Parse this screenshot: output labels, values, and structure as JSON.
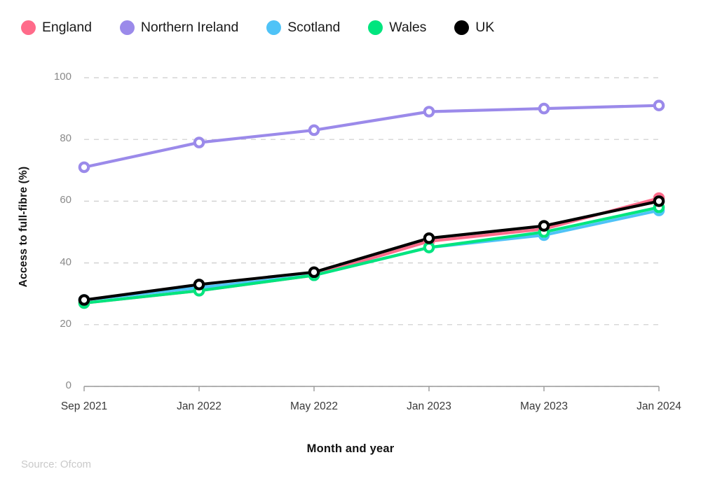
{
  "legend": {
    "position": "top-left",
    "items": [
      {
        "label": "England",
        "color": "#FF6B8A",
        "marker": "circle-swatch"
      },
      {
        "label": "Northern Ireland",
        "color": "#9B8AEA",
        "marker": "circle-swatch"
      },
      {
        "label": "Scotland",
        "color": "#4FC3F7",
        "marker": "circle-swatch"
      },
      {
        "label": "Wales",
        "color": "#00E57E",
        "marker": "circle-swatch"
      },
      {
        "label": "UK",
        "color": "#000000",
        "marker": "circle-swatch"
      }
    ]
  },
  "axes": {
    "y_title": "Access to full-fibre (%)",
    "x_title": "Month and year",
    "y_ticks": [
      "0",
      "20",
      "40",
      "60",
      "80",
      "100"
    ],
    "x_ticks": [
      "Sep 2021",
      "Jan 2022",
      "May 2022",
      "Jan 2023",
      "May 2023",
      "Jan 2024"
    ]
  },
  "source": "Source: Ofcom",
  "chart_data": {
    "type": "line",
    "title": "",
    "xlabel": "Month and year",
    "ylabel": "Access to full-fibre (%)",
    "categories": [
      "Sep 2021",
      "Jan 2022",
      "May 2022",
      "Jan 2023",
      "May 2023",
      "Jan 2024"
    ],
    "ylim": [
      0,
      100
    ],
    "yticks": [
      0,
      20,
      40,
      60,
      80,
      100
    ],
    "grid": "horizontal-dashed",
    "legend_position": "top-left",
    "markers": "open-circle",
    "series": [
      {
        "name": "England",
        "color": "#FF6B8A",
        "values": [
          27,
          31,
          36,
          47,
          51,
          61
        ]
      },
      {
        "name": "Northern Ireland",
        "color": "#9B8AEA",
        "values": [
          71,
          79,
          83,
          89,
          90,
          91
        ]
      },
      {
        "name": "Scotland",
        "color": "#4FC3F7",
        "values": [
          28,
          32,
          36,
          45,
          49,
          57
        ]
      },
      {
        "name": "Wales",
        "color": "#00E57E",
        "values": [
          27,
          31,
          36,
          45,
          50,
          58
        ]
      },
      {
        "name": "UK",
        "color": "#000000",
        "values": [
          28,
          33,
          37,
          48,
          52,
          60
        ]
      }
    ]
  }
}
